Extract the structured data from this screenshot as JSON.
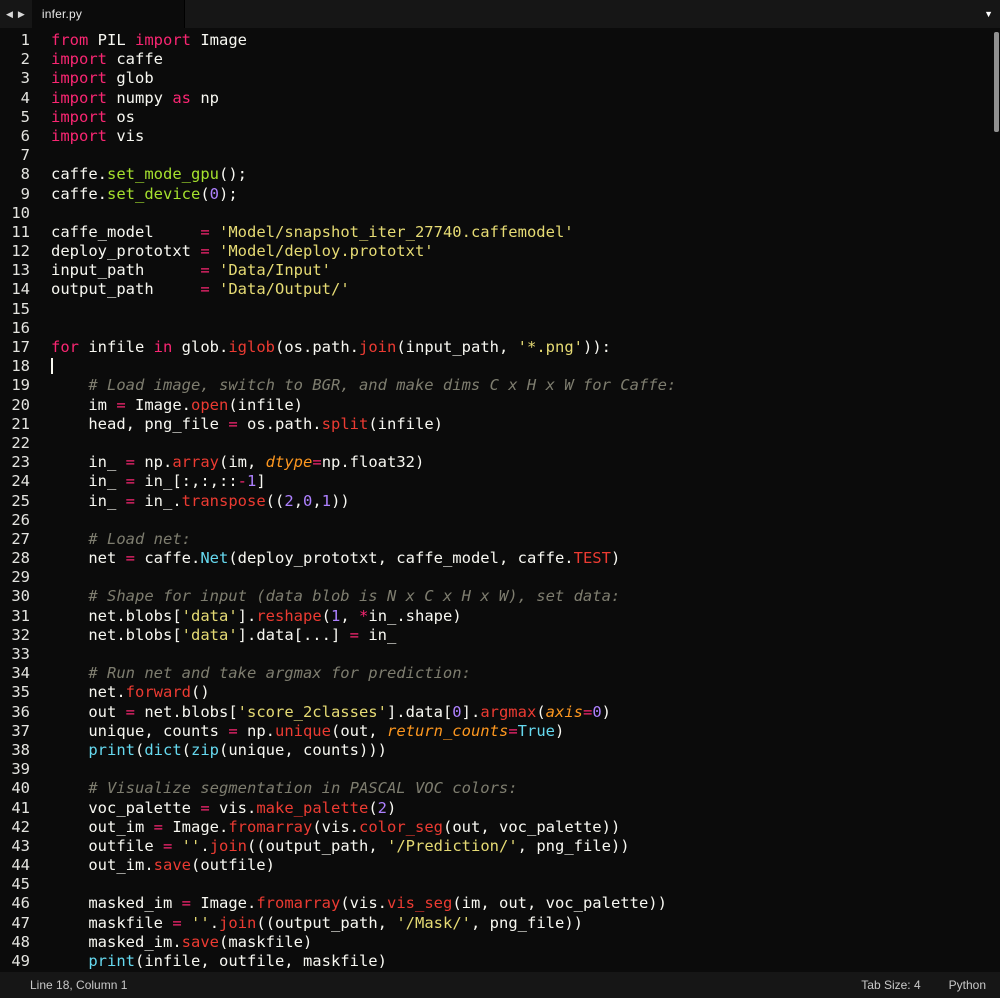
{
  "window": {
    "tab_scroll_left": "◀",
    "tab_scroll_right": "▶",
    "tab_title": "infer.py",
    "overflow_icon": "▼"
  },
  "status_bar": {
    "position": "Line 18, Column 1",
    "tab_size": "Tab Size: 4",
    "language": "Python"
  },
  "colors": {
    "background": "#0b0b0b",
    "plain": "#f8f8f2",
    "keyword": "#f92672",
    "string": "#e6db74",
    "number": "#ae81ff",
    "comment": "#7e7d6f",
    "function_red": "#ec3b32",
    "function_green": "#a6e22e",
    "builtin_cyan": "#66d9ef",
    "param_orange": "#fd971f"
  },
  "editor": {
    "cursor_line": 18,
    "lines": [
      {
        "n": 1,
        "t": [
          [
            "k",
            "from "
          ],
          [
            "w",
            "PIL "
          ],
          [
            "k",
            "import "
          ],
          [
            "w",
            "Image"
          ]
        ]
      },
      {
        "n": 2,
        "t": [
          [
            "k",
            "import "
          ],
          [
            "w",
            "caffe"
          ]
        ]
      },
      {
        "n": 3,
        "t": [
          [
            "k",
            "import "
          ],
          [
            "w",
            "glob"
          ]
        ]
      },
      {
        "n": 4,
        "t": [
          [
            "k",
            "import "
          ],
          [
            "w",
            "numpy "
          ],
          [
            "k",
            "as "
          ],
          [
            "w",
            "np"
          ]
        ]
      },
      {
        "n": 5,
        "t": [
          [
            "k",
            "import "
          ],
          [
            "w",
            "os"
          ]
        ]
      },
      {
        "n": 6,
        "t": [
          [
            "k",
            "import "
          ],
          [
            "w",
            "vis"
          ]
        ]
      },
      {
        "n": 7,
        "t": []
      },
      {
        "n": 8,
        "t": [
          [
            "w",
            "caffe."
          ],
          [
            "g",
            "set_mode_gpu"
          ],
          [
            "w",
            "();"
          ]
        ]
      },
      {
        "n": 9,
        "t": [
          [
            "w",
            "caffe."
          ],
          [
            "g",
            "set_device"
          ],
          [
            "w",
            "("
          ],
          [
            "n",
            "0"
          ],
          [
            "w",
            ");"
          ]
        ]
      },
      {
        "n": 10,
        "t": []
      },
      {
        "n": 11,
        "t": [
          [
            "w",
            "caffe_model     "
          ],
          [
            "k",
            "="
          ],
          [
            "w",
            " "
          ],
          [
            "s",
            "'Model/snapshot_iter_27740.caffemodel'"
          ]
        ]
      },
      {
        "n": 12,
        "t": [
          [
            "w",
            "deploy_prototxt "
          ],
          [
            "k",
            "="
          ],
          [
            "w",
            " "
          ],
          [
            "s",
            "'Model/deploy.prototxt'"
          ]
        ]
      },
      {
        "n": 13,
        "t": [
          [
            "w",
            "input_path      "
          ],
          [
            "k",
            "="
          ],
          [
            "w",
            " "
          ],
          [
            "s",
            "'Data/Input'"
          ]
        ]
      },
      {
        "n": 14,
        "t": [
          [
            "w",
            "output_path     "
          ],
          [
            "k",
            "="
          ],
          [
            "w",
            " "
          ],
          [
            "s",
            "'Data/Output/'"
          ]
        ]
      },
      {
        "n": 15,
        "t": []
      },
      {
        "n": 16,
        "t": []
      },
      {
        "n": 17,
        "t": [
          [
            "k",
            "for "
          ],
          [
            "w",
            "infile "
          ],
          [
            "k",
            "in "
          ],
          [
            "w",
            "glob."
          ],
          [
            "r",
            "iglob"
          ],
          [
            "w",
            "(os.path."
          ],
          [
            "r",
            "join"
          ],
          [
            "w",
            "(input_path, "
          ],
          [
            "s",
            "'*.png'"
          ],
          [
            "w",
            ")):"
          ]
        ]
      },
      {
        "n": 18,
        "t": []
      },
      {
        "n": 19,
        "t": [
          [
            "c",
            "    # Load image, switch to BGR, and make dims C x H x W for Caffe:"
          ]
        ]
      },
      {
        "n": 20,
        "t": [
          [
            "w",
            "    im "
          ],
          [
            "k",
            "="
          ],
          [
            "w",
            " Image."
          ],
          [
            "r",
            "open"
          ],
          [
            "w",
            "(infile)"
          ]
        ]
      },
      {
        "n": 21,
        "t": [
          [
            "w",
            "    head, png_file "
          ],
          [
            "k",
            "="
          ],
          [
            "w",
            " os.path."
          ],
          [
            "r",
            "split"
          ],
          [
            "w",
            "(infile)"
          ]
        ]
      },
      {
        "n": 22,
        "t": []
      },
      {
        "n": 23,
        "t": [
          [
            "w",
            "    in_ "
          ],
          [
            "k",
            "="
          ],
          [
            "w",
            " np."
          ],
          [
            "r",
            "array"
          ],
          [
            "w",
            "(im, "
          ],
          [
            "o",
            "dtype"
          ],
          [
            "k",
            "="
          ],
          [
            "w",
            "np.float32)"
          ]
        ]
      },
      {
        "n": 24,
        "t": [
          [
            "w",
            "    in_ "
          ],
          [
            "k",
            "="
          ],
          [
            "w",
            " in_[:,:,::"
          ],
          [
            "k",
            "-"
          ],
          [
            "n",
            "1"
          ],
          [
            "w",
            "]"
          ]
        ]
      },
      {
        "n": 25,
        "t": [
          [
            "w",
            "    in_ "
          ],
          [
            "k",
            "="
          ],
          [
            "w",
            " in_."
          ],
          [
            "r",
            "transpose"
          ],
          [
            "w",
            "(("
          ],
          [
            "n",
            "2"
          ],
          [
            "w",
            ","
          ],
          [
            "n",
            "0"
          ],
          [
            "w",
            ","
          ],
          [
            "n",
            "1"
          ],
          [
            "w",
            "))"
          ]
        ]
      },
      {
        "n": 26,
        "t": []
      },
      {
        "n": 27,
        "t": [
          [
            "c",
            "    # Load net:"
          ]
        ]
      },
      {
        "n": 28,
        "t": [
          [
            "w",
            "    net "
          ],
          [
            "k",
            "="
          ],
          [
            "w",
            " caffe."
          ],
          [
            "b",
            "Net"
          ],
          [
            "w",
            "(deploy_prototxt, caffe_model, caffe."
          ],
          [
            "r",
            "TEST"
          ],
          [
            "w",
            ")"
          ]
        ]
      },
      {
        "n": 29,
        "t": []
      },
      {
        "n": 30,
        "t": [
          [
            "c",
            "    # Shape for input (data blob is N x C x H x W), set data:"
          ]
        ]
      },
      {
        "n": 31,
        "t": [
          [
            "w",
            "    net.blobs["
          ],
          [
            "s",
            "'data'"
          ],
          [
            "w",
            "]."
          ],
          [
            "r",
            "reshape"
          ],
          [
            "w",
            "("
          ],
          [
            "n",
            "1"
          ],
          [
            "w",
            ", "
          ],
          [
            "k",
            "*"
          ],
          [
            "w",
            "in_.shape)"
          ]
        ]
      },
      {
        "n": 32,
        "t": [
          [
            "w",
            "    net.blobs["
          ],
          [
            "s",
            "'data'"
          ],
          [
            "w",
            "].data[...] "
          ],
          [
            "k",
            "="
          ],
          [
            "w",
            " in_"
          ]
        ]
      },
      {
        "n": 33,
        "t": []
      },
      {
        "n": 34,
        "t": [
          [
            "c",
            "    # Run net and take argmax for prediction:"
          ]
        ]
      },
      {
        "n": 35,
        "t": [
          [
            "w",
            "    net."
          ],
          [
            "r",
            "forward"
          ],
          [
            "w",
            "()"
          ]
        ]
      },
      {
        "n": 36,
        "t": [
          [
            "w",
            "    out "
          ],
          [
            "k",
            "="
          ],
          [
            "w",
            " net.blobs["
          ],
          [
            "s",
            "'score_2classes'"
          ],
          [
            "w",
            "].data["
          ],
          [
            "n",
            "0"
          ],
          [
            "w",
            "]."
          ],
          [
            "r",
            "argmax"
          ],
          [
            "w",
            "("
          ],
          [
            "o",
            "axis"
          ],
          [
            "k",
            "="
          ],
          [
            "n",
            "0"
          ],
          [
            "w",
            ")"
          ]
        ]
      },
      {
        "n": 37,
        "t": [
          [
            "w",
            "    unique, counts "
          ],
          [
            "k",
            "="
          ],
          [
            "w",
            " np."
          ],
          [
            "r",
            "unique"
          ],
          [
            "w",
            "(out, "
          ],
          [
            "o",
            "return_counts"
          ],
          [
            "k",
            "="
          ],
          [
            "b",
            "True"
          ],
          [
            "w",
            ")"
          ]
        ]
      },
      {
        "n": 38,
        "t": [
          [
            "w",
            "    "
          ],
          [
            "b",
            "print"
          ],
          [
            "w",
            "("
          ],
          [
            "b",
            "dict"
          ],
          [
            "w",
            "("
          ],
          [
            "b",
            "zip"
          ],
          [
            "w",
            "(unique, counts)))"
          ]
        ]
      },
      {
        "n": 39,
        "t": []
      },
      {
        "n": 40,
        "t": [
          [
            "c",
            "    # Visualize segmentation in PASCAL VOC colors:"
          ]
        ]
      },
      {
        "n": 41,
        "t": [
          [
            "w",
            "    voc_palette "
          ],
          [
            "k",
            "="
          ],
          [
            "w",
            " vis."
          ],
          [
            "r",
            "make_palette"
          ],
          [
            "w",
            "("
          ],
          [
            "n",
            "2"
          ],
          [
            "w",
            ")"
          ]
        ]
      },
      {
        "n": 42,
        "t": [
          [
            "w",
            "    out_im "
          ],
          [
            "k",
            "="
          ],
          [
            "w",
            " Image."
          ],
          [
            "r",
            "fromarray"
          ],
          [
            "w",
            "(vis."
          ],
          [
            "r",
            "color_seg"
          ],
          [
            "w",
            "(out, voc_palette))"
          ]
        ]
      },
      {
        "n": 43,
        "t": [
          [
            "w",
            "    outfile "
          ],
          [
            "k",
            "="
          ],
          [
            "w",
            " "
          ],
          [
            "s",
            "''"
          ],
          [
            "w",
            "."
          ],
          [
            "r",
            "join"
          ],
          [
            "w",
            "((output_path, "
          ],
          [
            "s",
            "'/Prediction/'"
          ],
          [
            "w",
            ", png_file))"
          ]
        ]
      },
      {
        "n": 44,
        "t": [
          [
            "w",
            "    out_im."
          ],
          [
            "r",
            "save"
          ],
          [
            "w",
            "(outfile)"
          ]
        ]
      },
      {
        "n": 45,
        "t": []
      },
      {
        "n": 46,
        "t": [
          [
            "w",
            "    masked_im "
          ],
          [
            "k",
            "="
          ],
          [
            "w",
            " Image."
          ],
          [
            "r",
            "fromarray"
          ],
          [
            "w",
            "(vis."
          ],
          [
            "r",
            "vis_seg"
          ],
          [
            "w",
            "(im, out, voc_palette))"
          ]
        ]
      },
      {
        "n": 47,
        "t": [
          [
            "w",
            "    maskfile "
          ],
          [
            "k",
            "="
          ],
          [
            "w",
            " "
          ],
          [
            "s",
            "''"
          ],
          [
            "w",
            "."
          ],
          [
            "r",
            "join"
          ],
          [
            "w",
            "((output_path, "
          ],
          [
            "s",
            "'/Mask/'"
          ],
          [
            "w",
            ", png_file))"
          ]
        ]
      },
      {
        "n": 48,
        "t": [
          [
            "w",
            "    masked_im."
          ],
          [
            "r",
            "save"
          ],
          [
            "w",
            "(maskfile)"
          ]
        ]
      },
      {
        "n": 49,
        "t": [
          [
            "w",
            "    "
          ],
          [
            "b",
            "print"
          ],
          [
            "w",
            "(infile, outfile, maskfile)"
          ]
        ]
      }
    ]
  }
}
